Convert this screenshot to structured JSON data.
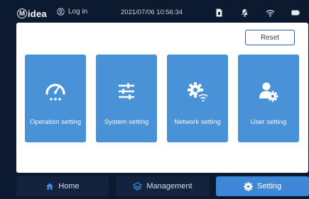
{
  "topbar": {
    "logo_text": "idea",
    "logo_mark": "M",
    "login_label": "Log in",
    "datetime": "2021/07/06  10:56:34",
    "icons": [
      "sim-card-icon",
      "bell-icon",
      "wifi-icon",
      "battery-icon"
    ]
  },
  "panel": {
    "reset_label": "Reset",
    "cards": [
      {
        "label": "Operation setting",
        "icon": "gauge-icon"
      },
      {
        "label": "System setting",
        "icon": "sliders-icon"
      },
      {
        "label": "Network setting",
        "icon": "network-gear-icon"
      },
      {
        "label": "User setting",
        "icon": "user-gear-icon"
      }
    ]
  },
  "nav": {
    "home_label": "Home",
    "management_label": "Management",
    "setting_label": "Setting",
    "active": "Setting"
  },
  "colors": {
    "background": "#0c1a30",
    "card": "#4a92d8",
    "active_tab": "#3d87d6",
    "reset_border": "#2f5fb0"
  }
}
